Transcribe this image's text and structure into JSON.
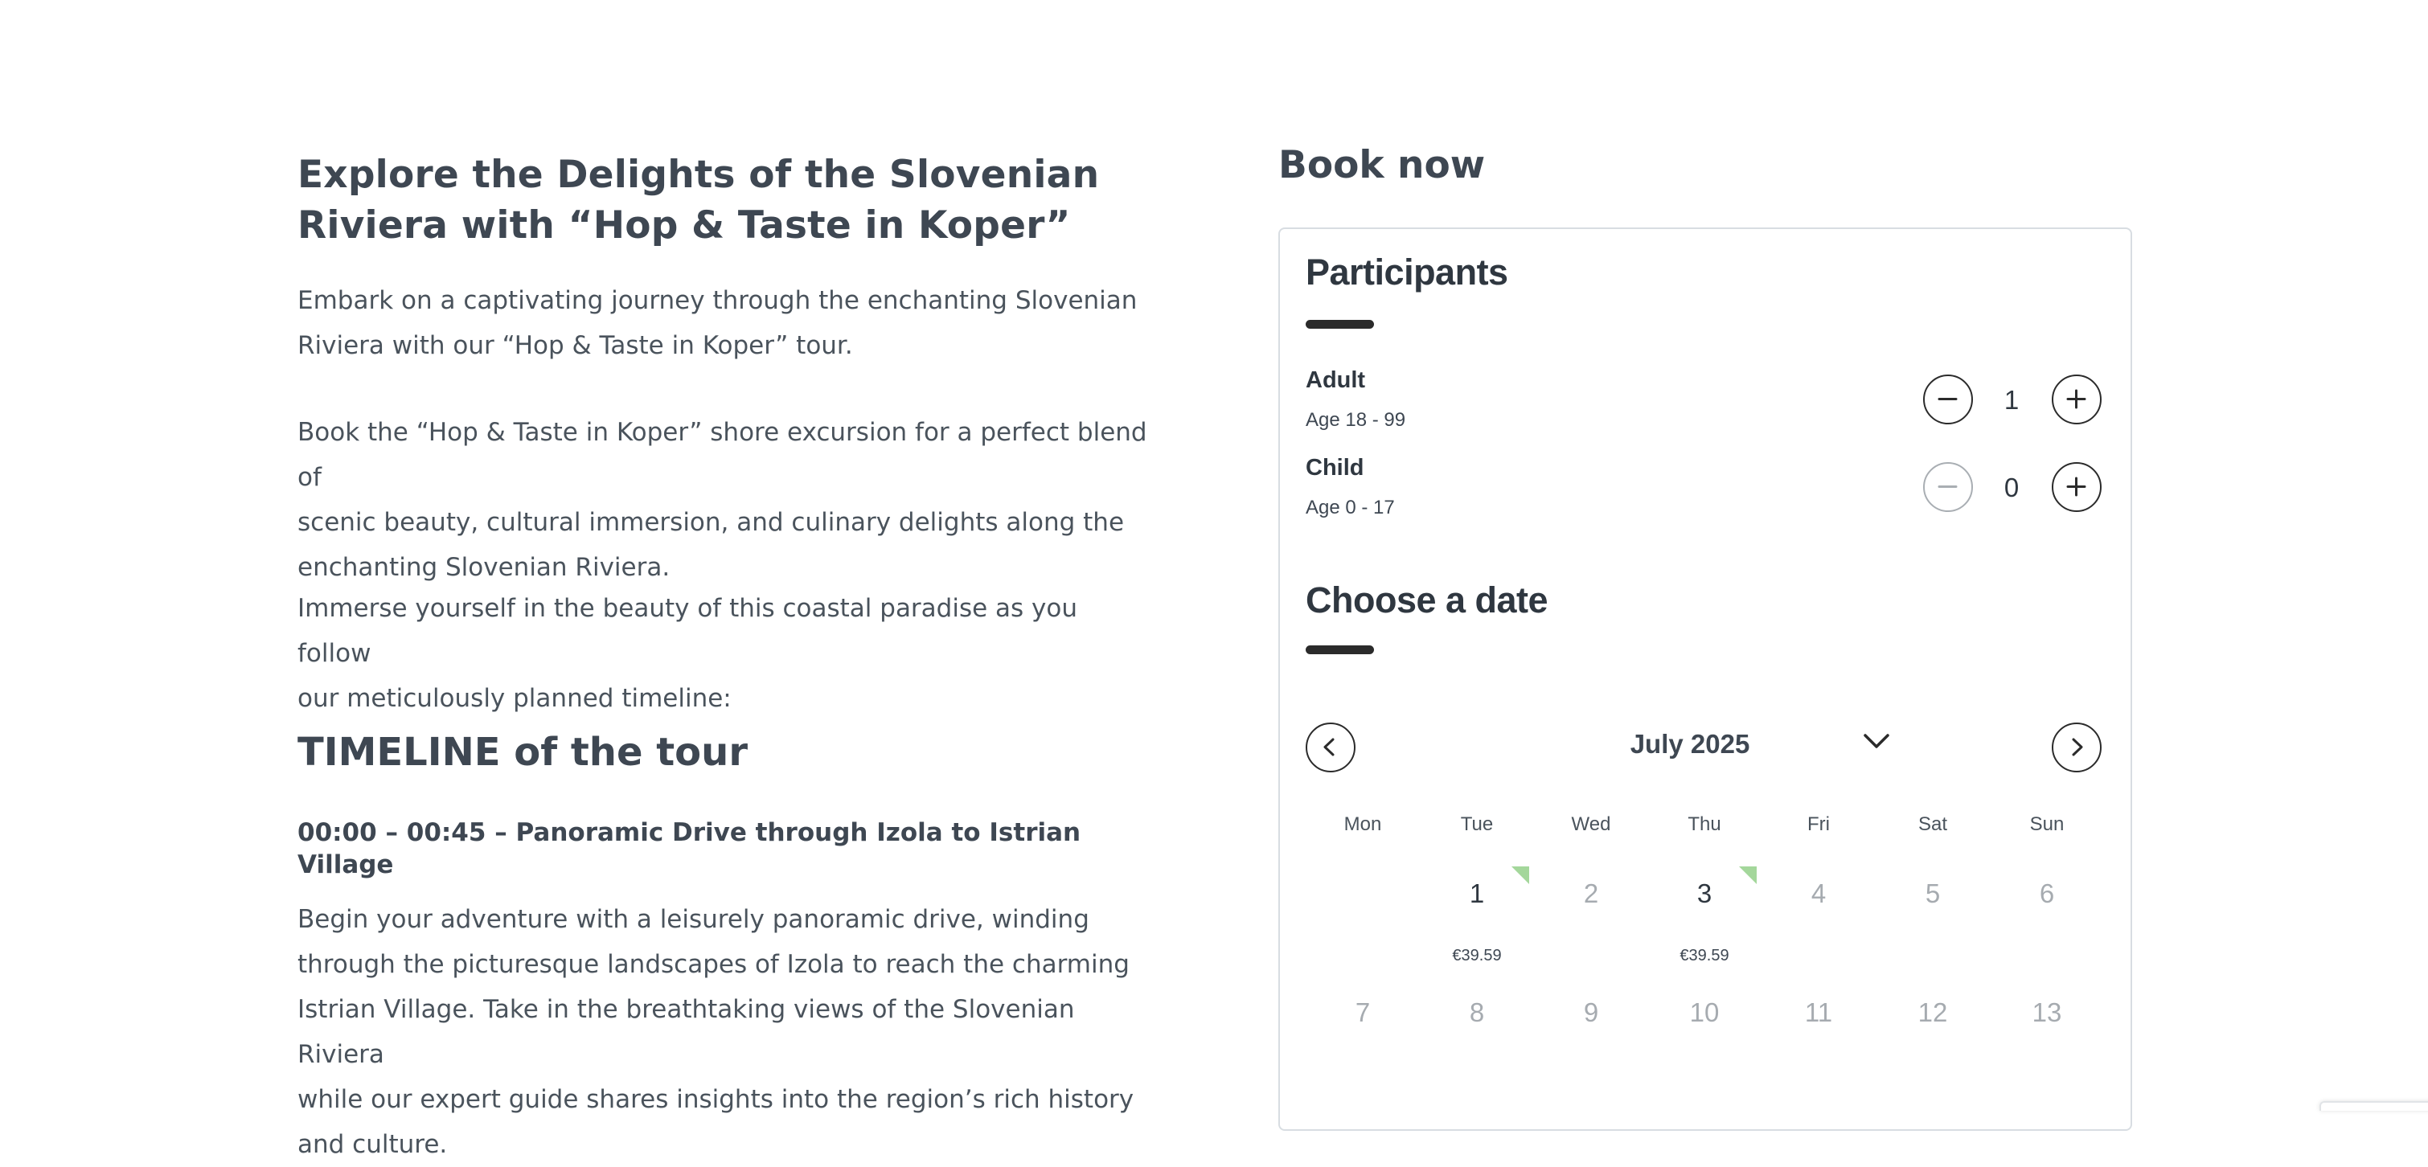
{
  "intro": {
    "title_line1": "Explore the Delights of the Slovenian",
    "title_line2": "Riviera with “Hop & Taste in Koper”",
    "p1_line1": "Embark on a captivating journey through the enchanting Slovenian",
    "p1_line2": "Riviera with our “Hop & Taste in Koper” tour.",
    "p2_line1": "Book the “Hop & Taste in Koper” shore excursion for a perfect blend of",
    "p2_line2": "scenic beauty, cultural immersion, and culinary delights along the",
    "p2_line3": "enchanting Slovenian Riviera.",
    "p3_line1": "Immerse yourself in the beauty of this coastal paradise as you follow",
    "p3_line2": "our meticulously planned timeline:"
  },
  "timeline": {
    "title": "TIMELINE of the tour",
    "segment_title": "00:00 – 00:45 – Panoramic Drive through Izola to Istrian Village",
    "p4_line1": "Begin your adventure with a leisurely panoramic drive, winding",
    "p4_line2": "through the picturesque landscapes of Izola to reach the charming",
    "p4_line3": "Istrian Village. Take in the breathtaking views of the Slovenian Riviera",
    "p4_line4": "while our expert guide shares insights into the region’s rich history",
    "p4_line5": "and culture."
  },
  "booking": {
    "title": "Book now",
    "participants_title": "Participants",
    "adult_label": "Adult",
    "adult_age": "Age 18 - 99",
    "adult_count": "1",
    "child_label": "Child",
    "child_age": "Age 0 - 17",
    "child_count": "0",
    "date_title": "Choose a date",
    "month": "July 2025",
    "weekdays": [
      "Mon",
      "Tue",
      "Wed",
      "Thu",
      "Fri",
      "Sat",
      "Sun"
    ],
    "week1": [
      "",
      "1",
      "2",
      "3",
      "4",
      "5",
      "6"
    ],
    "week1_prices": [
      "",
      "€39.59",
      "",
      "€39.59",
      "",
      "",
      ""
    ],
    "week2": [
      "7",
      "8",
      "9",
      "10",
      "11",
      "12",
      "13"
    ],
    "available_color": "#a4d79b"
  }
}
